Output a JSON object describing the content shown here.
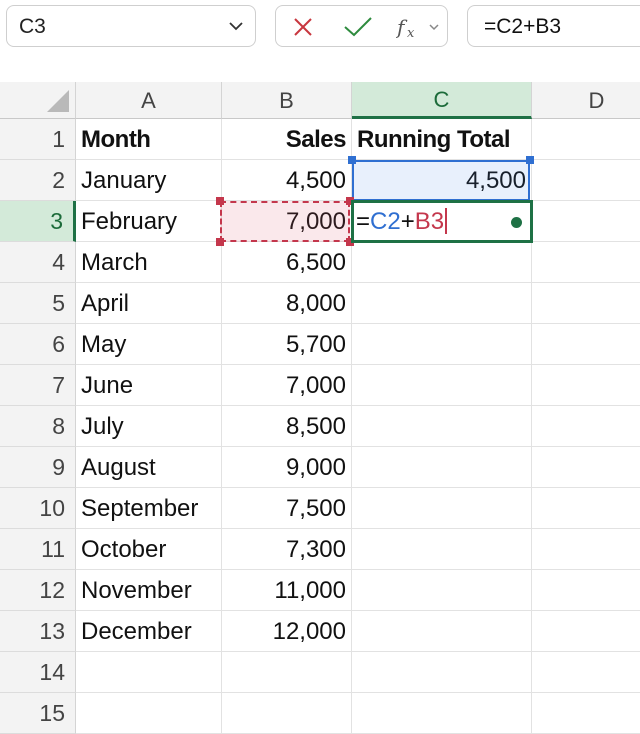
{
  "name_box": {
    "value": "C3"
  },
  "formula_bar": {
    "value": "=C2+B3"
  },
  "icons": {
    "cancel": "close-x-icon",
    "enter": "checkmark-icon",
    "function": "fx-icon"
  },
  "colors": {
    "accent_green": "#1e7145",
    "ref_blue": "#2f6fd1",
    "ref_red": "#c4374c"
  },
  "columns": [
    "A",
    "B",
    "C",
    "D"
  ],
  "rows": [
    "1",
    "2",
    "3",
    "4",
    "5",
    "6",
    "7",
    "8",
    "9",
    "10",
    "11",
    "12",
    "13",
    "14",
    "15"
  ],
  "header": {
    "month": "Month",
    "sales": "Sales",
    "running_total": "Running Total"
  },
  "data": [
    {
      "month": "January",
      "sales": "4,500"
    },
    {
      "month": "February",
      "sales": "7,000"
    },
    {
      "month": "March",
      "sales": "6,500"
    },
    {
      "month": "April",
      "sales": "8,000"
    },
    {
      "month": "May",
      "sales": "5,700"
    },
    {
      "month": "June",
      "sales": "7,000"
    },
    {
      "month": "July",
      "sales": "8,500"
    },
    {
      "month": "August",
      "sales": "9,000"
    },
    {
      "month": "September",
      "sales": "7,500"
    },
    {
      "month": "October",
      "sales": "7,300"
    },
    {
      "month": "November",
      "sales": "11,000"
    },
    {
      "month": "December",
      "sales": "12,000"
    }
  ],
  "c2_value": "4,500",
  "editing": {
    "eq": "=",
    "ref1": "C2",
    "op": "+",
    "ref2": "B3"
  }
}
